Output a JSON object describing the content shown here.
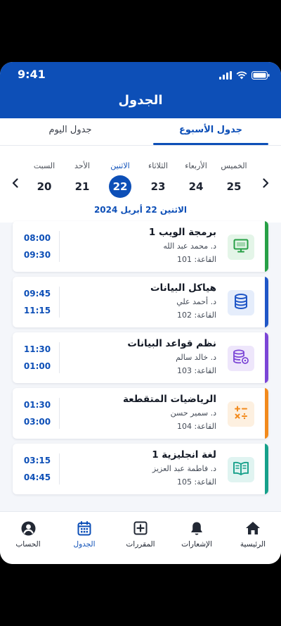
{
  "status_bar": {
    "time": "9:41"
  },
  "header": {
    "title": "الجدول"
  },
  "tabs": [
    {
      "label": "جدول الأسبوع",
      "active": true
    },
    {
      "label": "جدول اليوم",
      "active": false
    }
  ],
  "week": {
    "days": [
      {
        "name": "الخميس",
        "num": "25",
        "selected": false
      },
      {
        "name": "الأربعاء",
        "num": "24",
        "selected": false
      },
      {
        "name": "الثلاثاء",
        "num": "23",
        "selected": false
      },
      {
        "name": "الاثنين",
        "num": "22",
        "selected": true
      },
      {
        "name": "الأحد",
        "num": "21",
        "selected": false
      },
      {
        "name": "السبت",
        "num": "20",
        "selected": false
      }
    ],
    "selected_date": "الاثنين 22 أبريل 2024"
  },
  "classes": [
    {
      "course": "برمجة الويب 1",
      "teacher": "د. محمد عبد الله",
      "room": "القاعة: 101",
      "start": "08:00",
      "end": "09:30",
      "icon": "monitor-icon",
      "accent": "#27a046",
      "icon_bg": "#e4f5e8"
    },
    {
      "course": "هياكل البيانات",
      "teacher": "د. أحمد علي",
      "room": "القاعة: 102",
      "start": "09:45",
      "end": "11:15",
      "icon": "database-icon",
      "accent": "#1f56c7",
      "icon_bg": "#e5edfb"
    },
    {
      "course": "نظم قواعد البيانات",
      "teacher": "د. خالد سالم",
      "room": "القاعة: 103",
      "start": "11:30",
      "end": "01:00",
      "icon": "database-settings-icon",
      "accent": "#7b45d6",
      "icon_bg": "#eee6fb"
    },
    {
      "course": "الرياضيات المتقطعة",
      "teacher": "د. سمير حسن",
      "room": "القاعة: 104",
      "start": "01:30",
      "end": "03:00",
      "icon": "calculator-icon",
      "accent": "#f28a1c",
      "icon_bg": "#fdf0e0"
    },
    {
      "course": "لغة انجليزية 1",
      "teacher": "د. فاطمة عبد العزيز",
      "room": "القاعة: 105",
      "start": "03:15",
      "end": "04:45",
      "icon": "book-icon",
      "accent": "#16a08a",
      "icon_bg": "#e0f4f1"
    }
  ],
  "bottom_nav": [
    {
      "label": "الرئيسية",
      "icon": "home-icon",
      "active": false
    },
    {
      "label": "الإشعارات",
      "icon": "bell-icon",
      "active": false
    },
    {
      "label": "المقررات",
      "icon": "plus-square-icon",
      "active": false
    },
    {
      "label": "الجدول",
      "icon": "calendar-icon",
      "active": true
    },
    {
      "label": "الحساب",
      "icon": "user-icon",
      "active": false
    }
  ]
}
